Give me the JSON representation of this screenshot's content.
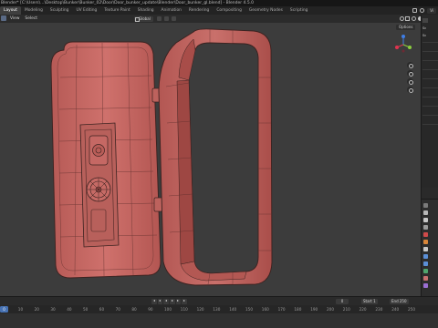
{
  "window": {
    "title": "Blender* [C:\\Users\\...\\Desktop\\Bunker\\Bunker_02\\Door\\Door_bunker_update\\Blender\\Door_bunker_gl.blend] - Blender 4.5.0"
  },
  "workspaces": {
    "tabs": [
      "Layout",
      "Modeling",
      "Sculpting",
      "UV Editing",
      "Texture Paint",
      "Shading",
      "Animation",
      "Rendering",
      "Compositing",
      "Geometry Nodes",
      "Scripting"
    ],
    "active": "Layout"
  },
  "top_right": {
    "view_layer_label": "Vi"
  },
  "viewport_header": {
    "menu_items": [
      "View",
      "Select"
    ],
    "orientation": "Global"
  },
  "overlay": {
    "options_label": "Options"
  },
  "gizmo": {
    "x_label": "X",
    "y_label": "Y",
    "z_label": "Z",
    "x_color": "#e0344f",
    "y_color": "#8ccf3e",
    "z_color": "#3f7ee6"
  },
  "sidebar": {
    "tags": [
      "Sc",
      "Sc"
    ]
  },
  "timeline": {
    "current_frame": "0",
    "start_label": "Start",
    "start_value": "1",
    "end_label": "End",
    "end_value": "250",
    "ruler_ticks": [
      "0",
      "10",
      "20",
      "30",
      "40",
      "50",
      "60",
      "70",
      "80",
      "90",
      "100",
      "110",
      "120",
      "130",
      "140",
      "150",
      "160",
      "170",
      "180",
      "190",
      "200",
      "210",
      "220",
      "230",
      "240",
      "250"
    ]
  },
  "colors": {
    "mesh_fill": "#c86a66",
    "mesh_wire": "#3b2220",
    "viewport_bg": "#3c3c3c",
    "accent": "#4772b3"
  }
}
